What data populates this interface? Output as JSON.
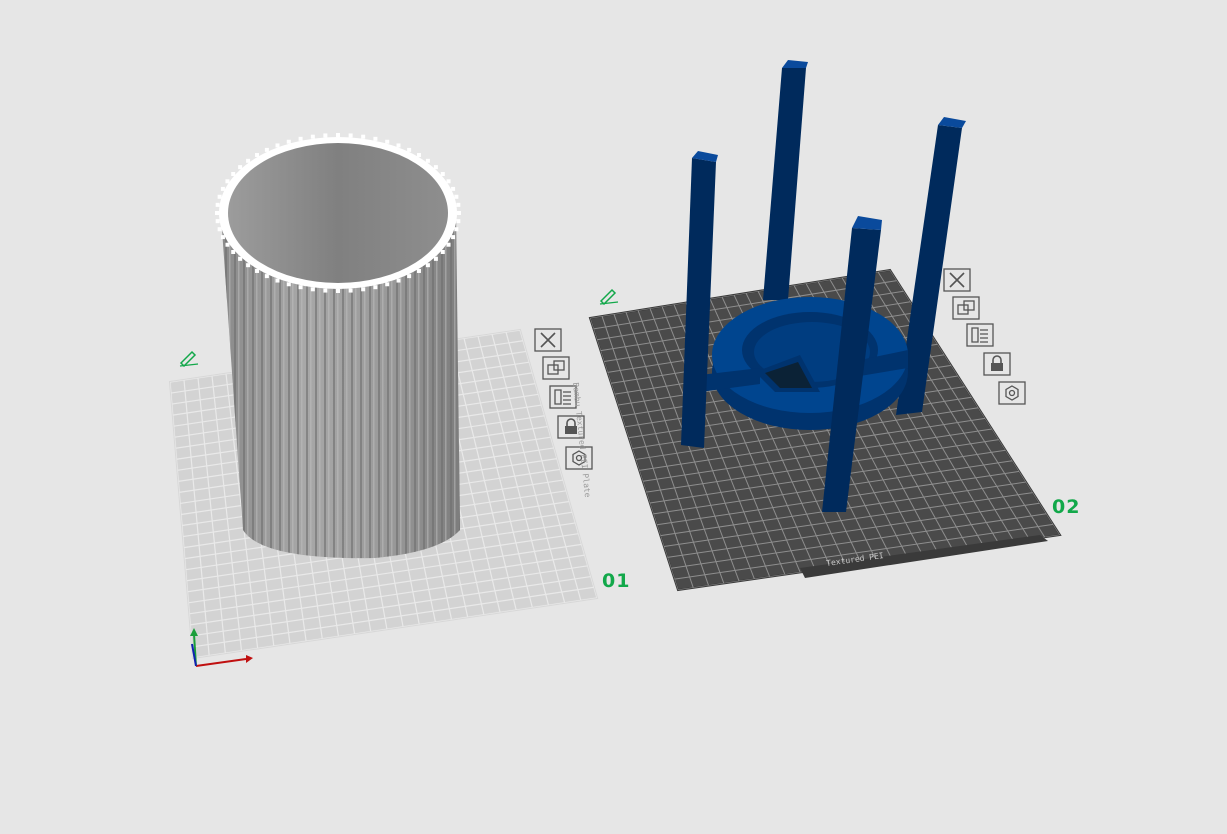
{
  "plates": [
    {
      "label": "01",
      "surface": "default",
      "tools": [
        "close-icon",
        "arrange-icon",
        "orient-icon",
        "lock-icon",
        "settings-icon"
      ]
    },
    {
      "label": "02",
      "surface": "textured-pei",
      "plate_side_text": "Bambu Textured PEI Plate",
      "plate_tab_text": "Textured PEI",
      "tools": [
        "close-icon",
        "arrange-icon",
        "orient-icon",
        "lock-icon",
        "settings-icon"
      ]
    }
  ],
  "colors": {
    "background": "#e6e6e6",
    "plate_label": "#12a84a",
    "model_gray": "#8c8c8c",
    "model_blue": "#003f8a"
  }
}
